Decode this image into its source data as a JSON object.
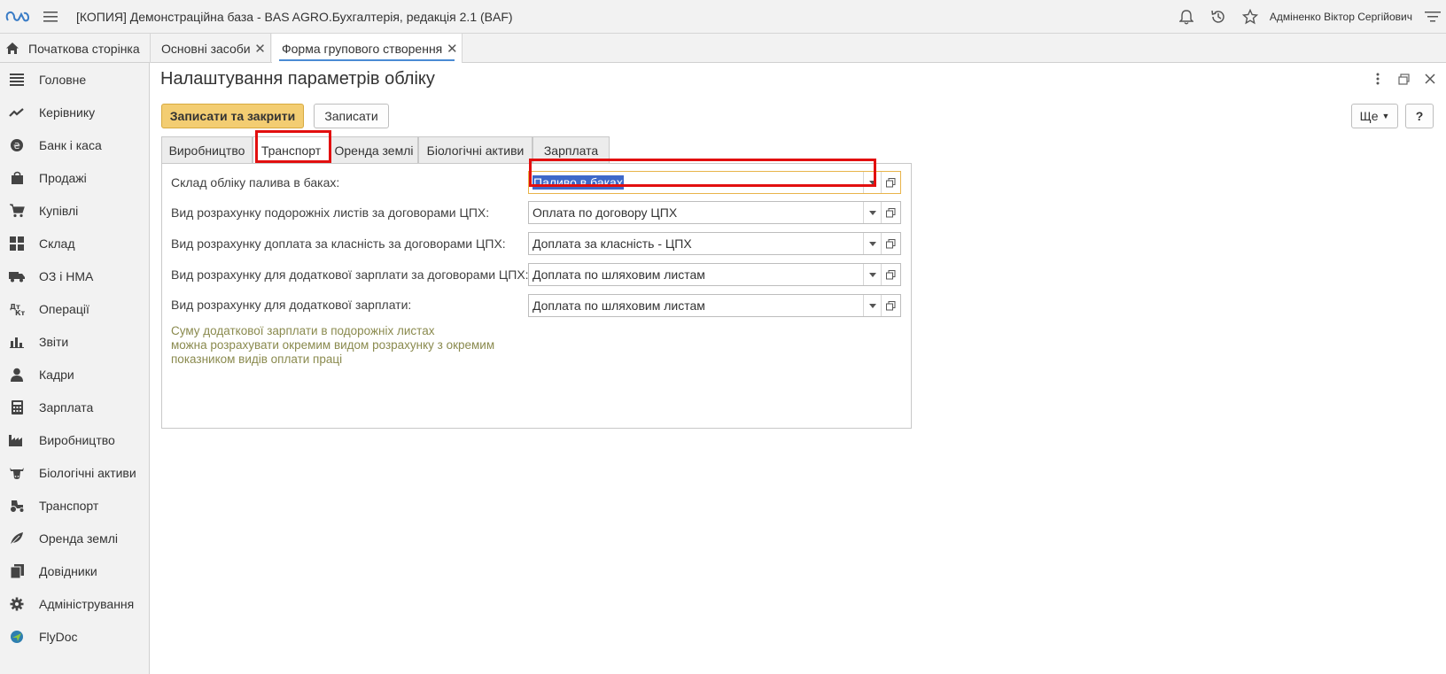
{
  "app": {
    "title": "[КОПИЯ] Демонстраційна база - BAS AGRO.Бухгалтерія, редакція 2.1  (BAF)",
    "user": "Адміненко Віктор Сергійович"
  },
  "tabs": {
    "home": "Початкова сторінка",
    "open": [
      {
        "label": "Основні засоби"
      },
      {
        "label": "Форма групового створення"
      }
    ]
  },
  "sidebar": {
    "items": [
      {
        "label": "Головне",
        "icon": "list-icon"
      },
      {
        "label": "Керівнику",
        "icon": "trend-icon"
      },
      {
        "label": "Банк і каса",
        "icon": "coin-icon"
      },
      {
        "label": "Продажі",
        "icon": "bag-icon"
      },
      {
        "label": "Купівлі",
        "icon": "cart-icon"
      },
      {
        "label": "Склад",
        "icon": "grid-icon"
      },
      {
        "label": "ОЗ і НМА",
        "icon": "truck-icon"
      },
      {
        "label": "Операції",
        "icon": "dt-kt-icon"
      },
      {
        "label": "Звіти",
        "icon": "bar-chart-icon"
      },
      {
        "label": "Кадри",
        "icon": "person-icon"
      },
      {
        "label": "Зарплата",
        "icon": "calculator-icon"
      },
      {
        "label": "Виробництво",
        "icon": "factory-icon"
      },
      {
        "label": "Біологічні активи",
        "icon": "cow-icon"
      },
      {
        "label": "Транспорт",
        "icon": "tractor-icon"
      },
      {
        "label": "Оренда землі",
        "icon": "leaf-icon"
      },
      {
        "label": "Довідники",
        "icon": "books-icon"
      },
      {
        "label": "Адміністрування",
        "icon": "gear-icon"
      },
      {
        "label": "FlyDoc",
        "icon": "flydoc-icon"
      }
    ]
  },
  "form": {
    "title": "Налаштування параметрів обліку",
    "save_close": "Записати та закрити",
    "save": "Записати",
    "more": "Ще",
    "help": "?",
    "tabs": [
      "Виробництво",
      "Транспорт",
      "Оренда землі",
      "Біологічні активи",
      "Зарплата"
    ],
    "active_tab": "Транспорт",
    "fields": [
      {
        "label": "Склад обліку палива в баках:",
        "value": "Паливо в баках"
      },
      {
        "label": "Вид розрахунку подорожніх листів за договорами ЦПХ:",
        "value": "Оплата по договору ЦПХ"
      },
      {
        "label": "Вид розрахунку доплата за класність за договорами ЦПХ:",
        "value": "Доплата за класність - ЦПХ"
      },
      {
        "label": "Вид розрахунку для додаткової зарплати за договорами ЦПХ:",
        "value": "Доплата по шляховим листам"
      },
      {
        "label": "Вид розрахунку для додаткової зарплати:",
        "value": "Доплата по шляховим листам"
      }
    ],
    "note": "Суму додаткової зарплати в подорожніх листах\n можна розрахувати окремим видом розрахунку з окремим\nпоказником видів оплати праці"
  },
  "colors": {
    "accent_button": "#f3cd72",
    "highlight_box": "#e20f0f",
    "selection": "#3f69c9",
    "note_text": "#8a8a4e"
  }
}
